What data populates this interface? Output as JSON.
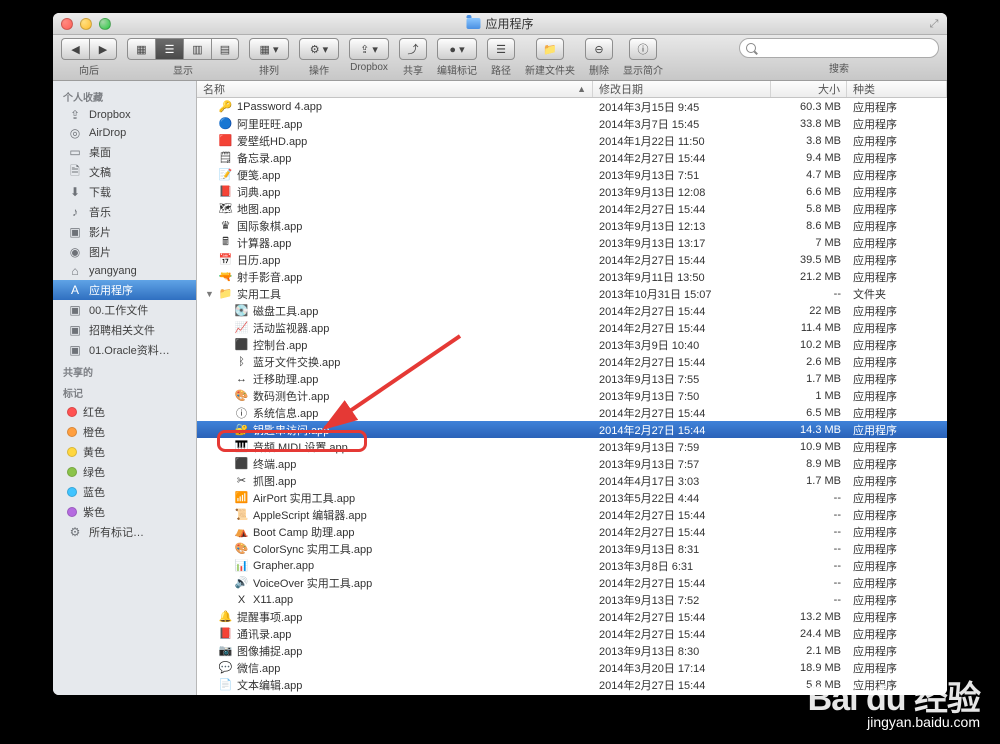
{
  "window": {
    "title": "应用程序"
  },
  "toolbar": {
    "back_forward": "向后",
    "view": "显示",
    "arrange": "排列",
    "action": "操作",
    "dropbox": "Dropbox",
    "share": "共享",
    "edit_tags": "编辑标记",
    "path": "路径",
    "new_folder": "新建文件夹",
    "delete": "删除",
    "get_info": "显示简介",
    "search_label": "搜索"
  },
  "sidebar": {
    "favorites_header": "个人收藏",
    "favorites": [
      {
        "icon": "⇪",
        "label": "Dropbox"
      },
      {
        "icon": "◎",
        "label": "AirDrop"
      },
      {
        "icon": "▭",
        "label": "桌面"
      },
      {
        "icon": "🗎",
        "label": "文稿"
      },
      {
        "icon": "⬇",
        "label": "下载"
      },
      {
        "icon": "♪",
        "label": "音乐"
      },
      {
        "icon": "▣",
        "label": "影片"
      },
      {
        "icon": "◉",
        "label": "图片"
      },
      {
        "icon": "⌂",
        "label": "yangyang"
      },
      {
        "icon": "A",
        "label": "应用程序",
        "selected": true
      },
      {
        "icon": "▣",
        "label": "00.工作文件"
      },
      {
        "icon": "▣",
        "label": "招聘相关文件"
      },
      {
        "icon": "▣",
        "label": "01.Oracle资料…"
      }
    ],
    "shared_header": "共享的",
    "tags_header": "标记",
    "tags": [
      {
        "color": "#ff5252",
        "label": "红色"
      },
      {
        "color": "#ff9f40",
        "label": "橙色"
      },
      {
        "color": "#ffd740",
        "label": "黄色"
      },
      {
        "color": "#8bc34a",
        "label": "绿色"
      },
      {
        "color": "#40c4ff",
        "label": "蓝色"
      },
      {
        "color": "#b56be0",
        "label": "紫色"
      }
    ],
    "all_tags": "所有标记…"
  },
  "columns": {
    "name": "名称",
    "date": "修改日期",
    "size": "大小",
    "kind": "种类"
  },
  "rows": [
    {
      "indent": 0,
      "tri": "",
      "icon": "🔑",
      "name": "1Password 4.app",
      "date": "2014年3月15日 9:45",
      "size": "60.3 MB",
      "kind": "应用程序"
    },
    {
      "indent": 0,
      "tri": "",
      "icon": "🔵",
      "name": "阿里旺旺.app",
      "date": "2014年3月7日 15:45",
      "size": "33.8 MB",
      "kind": "应用程序"
    },
    {
      "indent": 0,
      "tri": "",
      "icon": "🟥",
      "name": "爱壁纸HD.app",
      "date": "2014年1月22日 11:50",
      "size": "3.8 MB",
      "kind": "应用程序"
    },
    {
      "indent": 0,
      "tri": "",
      "icon": "🗒",
      "name": "备忘录.app",
      "date": "2014年2月27日 15:44",
      "size": "9.4 MB",
      "kind": "应用程序"
    },
    {
      "indent": 0,
      "tri": "",
      "icon": "📝",
      "name": "便笺.app",
      "date": "2013年9月13日 7:51",
      "size": "4.7 MB",
      "kind": "应用程序"
    },
    {
      "indent": 0,
      "tri": "",
      "icon": "📕",
      "name": "词典.app",
      "date": "2013年9月13日 12:08",
      "size": "6.6 MB",
      "kind": "应用程序"
    },
    {
      "indent": 0,
      "tri": "",
      "icon": "🗺",
      "name": "地图.app",
      "date": "2014年2月27日 15:44",
      "size": "5.8 MB",
      "kind": "应用程序"
    },
    {
      "indent": 0,
      "tri": "",
      "icon": "♛",
      "name": "国际象棋.app",
      "date": "2013年9月13日 12:13",
      "size": "8.6 MB",
      "kind": "应用程序"
    },
    {
      "indent": 0,
      "tri": "",
      "icon": "🖩",
      "name": "计算器.app",
      "date": "2013年9月13日 13:17",
      "size": "7 MB",
      "kind": "应用程序"
    },
    {
      "indent": 0,
      "tri": "",
      "icon": "📅",
      "name": "日历.app",
      "date": "2014年2月27日 15:44",
      "size": "39.5 MB",
      "kind": "应用程序"
    },
    {
      "indent": 0,
      "tri": "",
      "icon": "🔫",
      "name": "射手影音.app",
      "date": "2013年9月11日 13:50",
      "size": "21.2 MB",
      "kind": "应用程序"
    },
    {
      "indent": 0,
      "tri": "▼",
      "icon": "📁",
      "name": "实用工具",
      "date": "2013年10月31日 15:07",
      "size": "--",
      "kind": "文件夹"
    },
    {
      "indent": 1,
      "tri": "",
      "icon": "💽",
      "name": "磁盘工具.app",
      "date": "2014年2月27日 15:44",
      "size": "22 MB",
      "kind": "应用程序"
    },
    {
      "indent": 1,
      "tri": "",
      "icon": "📈",
      "name": "活动监视器.app",
      "date": "2014年2月27日 15:44",
      "size": "11.4 MB",
      "kind": "应用程序"
    },
    {
      "indent": 1,
      "tri": "",
      "icon": "⬛",
      "name": "控制台.app",
      "date": "2013年3月9日 10:40",
      "size": "10.2 MB",
      "kind": "应用程序"
    },
    {
      "indent": 1,
      "tri": "",
      "icon": "ᛒ",
      "name": "蓝牙文件交换.app",
      "date": "2014年2月27日 15:44",
      "size": "2.6 MB",
      "kind": "应用程序"
    },
    {
      "indent": 1,
      "tri": "",
      "icon": "↔",
      "name": "迁移助理.app",
      "date": "2013年9月13日 7:55",
      "size": "1.7 MB",
      "kind": "应用程序"
    },
    {
      "indent": 1,
      "tri": "",
      "icon": "🎨",
      "name": "数码测色计.app",
      "date": "2013年9月13日 7:50",
      "size": "1 MB",
      "kind": "应用程序"
    },
    {
      "indent": 1,
      "tri": "",
      "icon": "ⓘ",
      "name": "系统信息.app",
      "date": "2014年2月27日 15:44",
      "size": "6.5 MB",
      "kind": "应用程序"
    },
    {
      "indent": 1,
      "tri": "",
      "icon": "🔐",
      "name": "钥匙串访问.app",
      "date": "2014年2月27日 15:44",
      "size": "14.3 MB",
      "kind": "应用程序",
      "selected": true
    },
    {
      "indent": 1,
      "tri": "",
      "icon": "🎹",
      "name": "音频 MIDI 设置.app",
      "date": "2013年9月13日 7:59",
      "size": "10.9 MB",
      "kind": "应用程序"
    },
    {
      "indent": 1,
      "tri": "",
      "icon": "⬛",
      "name": "终端.app",
      "date": "2013年9月13日 7:57",
      "size": "8.9 MB",
      "kind": "应用程序"
    },
    {
      "indent": 1,
      "tri": "",
      "icon": "✂",
      "name": "抓图.app",
      "date": "2014年4月17日 3:03",
      "size": "1.7 MB",
      "kind": "应用程序"
    },
    {
      "indent": 1,
      "tri": "",
      "icon": "📶",
      "name": "AirPort 实用工具.app",
      "date": "2013年5月22日 4:44",
      "size": "--",
      "kind": "应用程序"
    },
    {
      "indent": 1,
      "tri": "",
      "icon": "📜",
      "name": "AppleScript 编辑器.app",
      "date": "2014年2月27日 15:44",
      "size": "--",
      "kind": "应用程序"
    },
    {
      "indent": 1,
      "tri": "",
      "icon": "⛺",
      "name": "Boot Camp 助理.app",
      "date": "2014年2月27日 15:44",
      "size": "--",
      "kind": "应用程序"
    },
    {
      "indent": 1,
      "tri": "",
      "icon": "🎨",
      "name": "ColorSync 实用工具.app",
      "date": "2013年9月13日 8:31",
      "size": "--",
      "kind": "应用程序"
    },
    {
      "indent": 1,
      "tri": "",
      "icon": "📊",
      "name": "Grapher.app",
      "date": "2013年3月8日 6:31",
      "size": "--",
      "kind": "应用程序"
    },
    {
      "indent": 1,
      "tri": "",
      "icon": "🔊",
      "name": "VoiceOver 实用工具.app",
      "date": "2014年2月27日 15:44",
      "size": "--",
      "kind": "应用程序"
    },
    {
      "indent": 1,
      "tri": "",
      "icon": "X",
      "name": "X11.app",
      "date": "2013年9月13日 7:52",
      "size": "--",
      "kind": "应用程序"
    },
    {
      "indent": 0,
      "tri": "",
      "icon": "🔔",
      "name": "提醒事项.app",
      "date": "2014年2月27日 15:44",
      "size": "13.2 MB",
      "kind": "应用程序"
    },
    {
      "indent": 0,
      "tri": "",
      "icon": "📕",
      "name": "通讯录.app",
      "date": "2014年2月27日 15:44",
      "size": "24.4 MB",
      "kind": "应用程序"
    },
    {
      "indent": 0,
      "tri": "",
      "icon": "📷",
      "name": "图像捕捉.app",
      "date": "2013年9月13日 8:30",
      "size": "2.1 MB",
      "kind": "应用程序"
    },
    {
      "indent": 0,
      "tri": "",
      "icon": "💬",
      "name": "微信.app",
      "date": "2014年3月20日 17:14",
      "size": "18.9 MB",
      "kind": "应用程序"
    },
    {
      "indent": 0,
      "tri": "",
      "icon": "📄",
      "name": "文本编辑.app",
      "date": "2014年2月27日 15:44",
      "size": "5.8 MB",
      "kind": "应用程序"
    }
  ],
  "watermark": {
    "logo": "Bai du 经验",
    "sub": "jingyan.baidu.com"
  }
}
